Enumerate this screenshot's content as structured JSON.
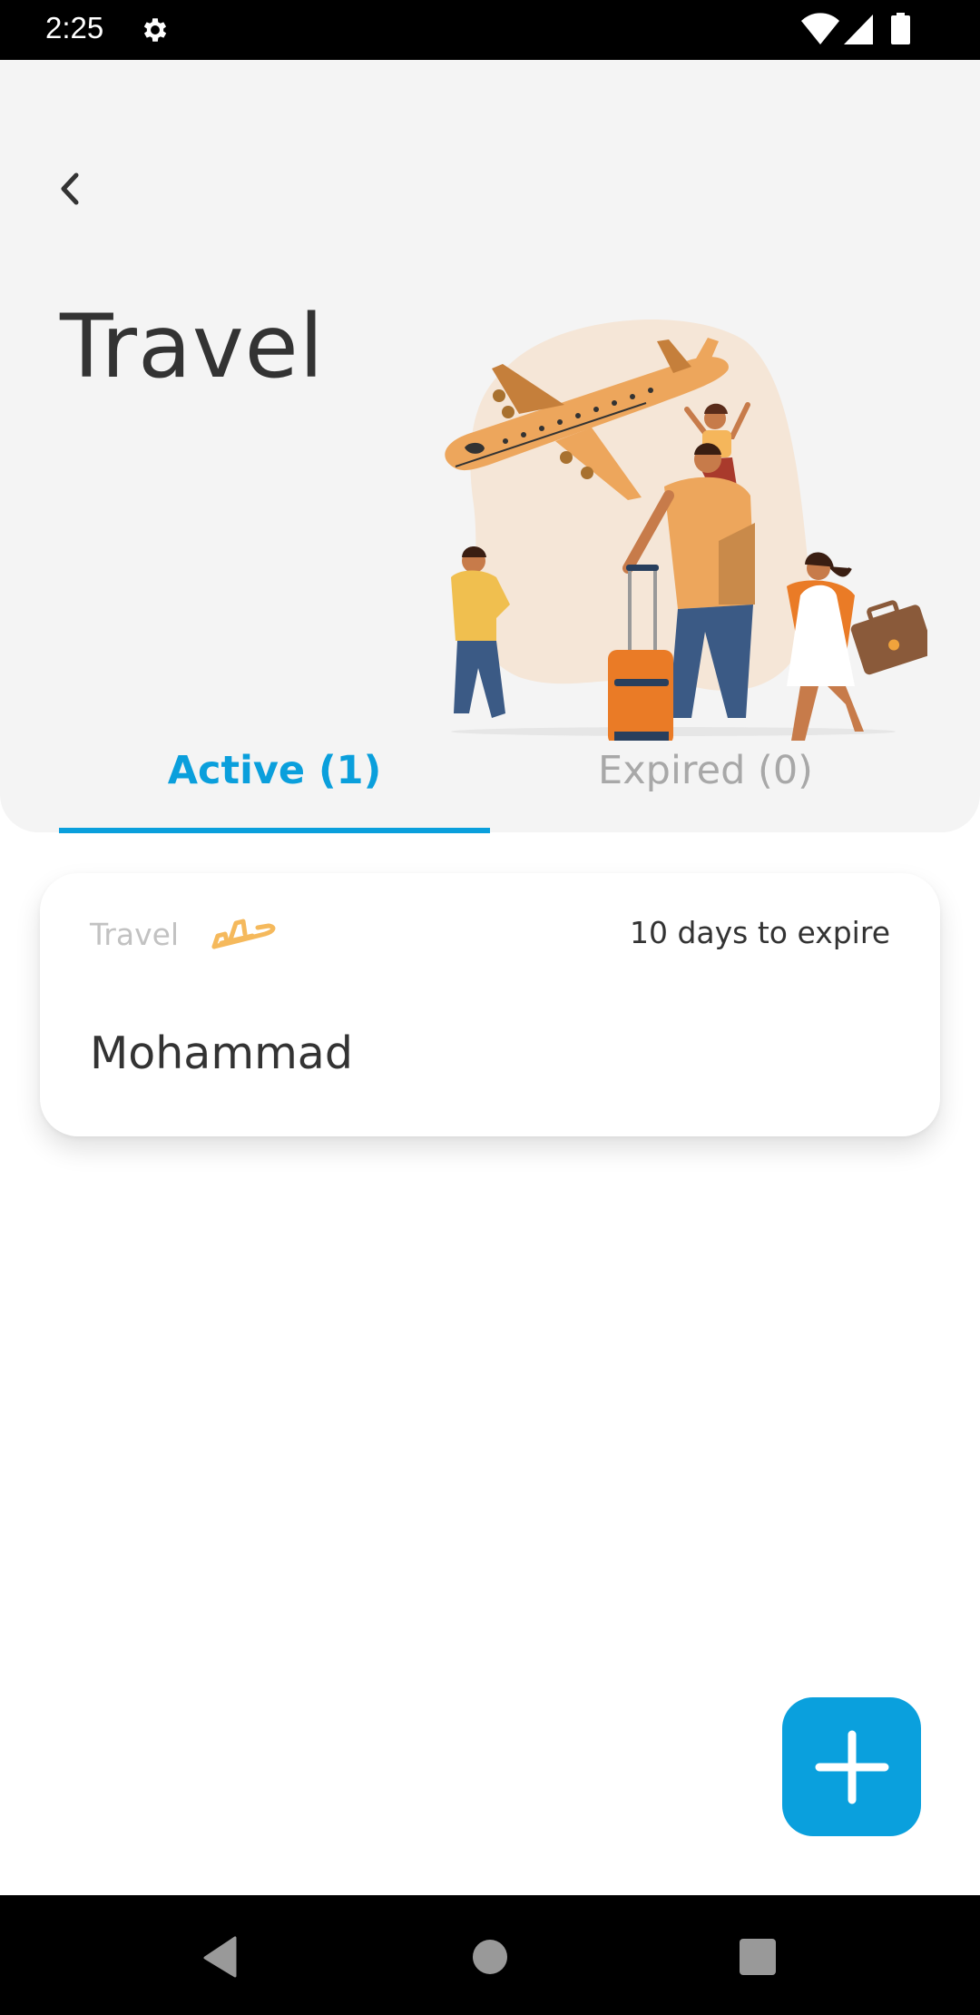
{
  "status_bar": {
    "time": "2:25",
    "icons": [
      "settings-gear-icon",
      "wifi-icon",
      "cellular-signal-icon",
      "battery-icon"
    ]
  },
  "header": {
    "back_icon": "chevron-left-icon",
    "title": "Travel",
    "illustration": "family-travel-illustration"
  },
  "tabs": [
    {
      "label": "Active (1)",
      "selected": true
    },
    {
      "label": "Expired (0)",
      "selected": false
    }
  ],
  "policies": [
    {
      "type": "Travel",
      "type_icon": "airplane-icon",
      "expiry": "10 days to expire",
      "holder_name": "Mohammad"
    }
  ],
  "fab": {
    "icon": "plus-icon"
  },
  "nav_bar": {
    "buttons": [
      "back-triangle-icon",
      "home-circle-icon",
      "recents-square-icon"
    ]
  },
  "colors": {
    "accent": "#0aa0dd",
    "header_bg": "#f4f4f4",
    "title_text": "#333333",
    "inactive_tab": "#a8a8a8",
    "travel_icon": "#f5b95c"
  }
}
